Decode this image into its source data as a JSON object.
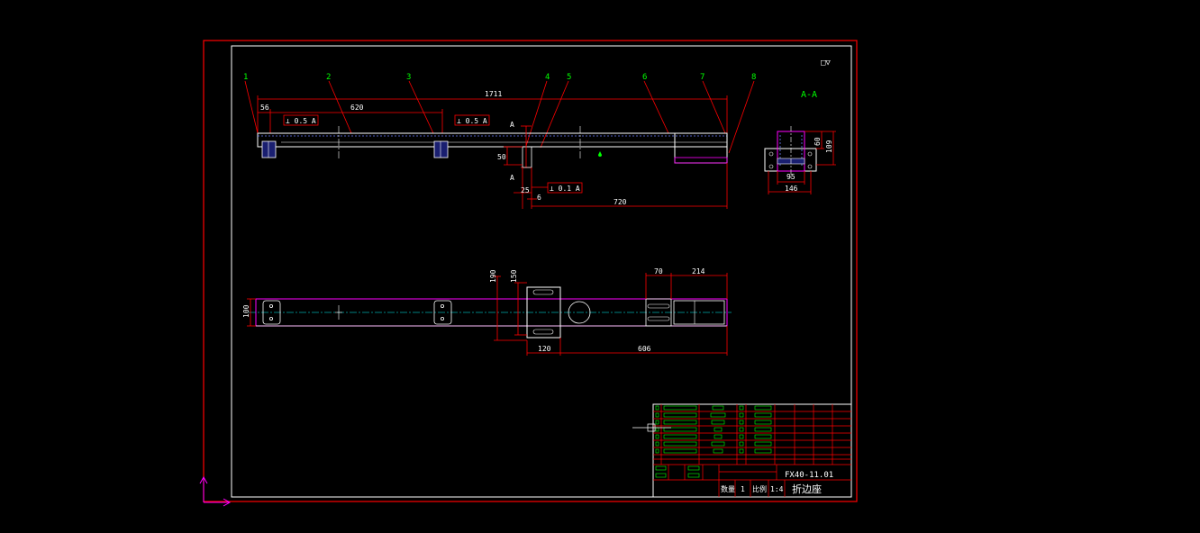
{
  "colors": {
    "background": "#000000",
    "frame": "#ff0000",
    "inner_frame": "#ffffff",
    "dimension": "#ff0000",
    "dimension_text": "#ffffff",
    "label": "#00ff00",
    "part": "#ffffff",
    "part_accent": "#ff00ff",
    "hidden": "#6a7dff",
    "center_line": "#00ffff",
    "title_lines": "#ff0000",
    "ucs": "#ff00ff"
  },
  "part_numbers": [
    "1",
    "2",
    "3",
    "4",
    "5",
    "6",
    "7",
    "8"
  ],
  "side_view": {
    "dims": {
      "overall": "1711",
      "left_offset": "56",
      "bracket_pitch": "620",
      "tolerance_1": "⊥ 0.5 A",
      "tolerance_2": "⊥ 0.5 A",
      "tolerance_3": "⊥ 0.1 A",
      "section_mark_top": "A",
      "section_mark_bottom": "A",
      "height_50": "50",
      "dim_25": "25",
      "dim_6": "6",
      "dim_720": "720"
    }
  },
  "section_view": {
    "title": "A-A",
    "dims": {
      "width_95": "95",
      "width_146": "146",
      "height_60": "60",
      "height_109": "109"
    }
  },
  "surface_mark": "□▽",
  "top_view": {
    "dims": {
      "width_100": "100",
      "dim_190": "190",
      "dim_150": "150",
      "dim_120": "120",
      "dim_606": "606",
      "dim_70": "70",
      "dim_214": "214"
    }
  },
  "title_block": {
    "drawing_no": "FX40-11.01",
    "part_name": "折边座",
    "quantity_label": "数量",
    "quantity": "1",
    "scale_label": "比例",
    "scale": "1:4"
  }
}
